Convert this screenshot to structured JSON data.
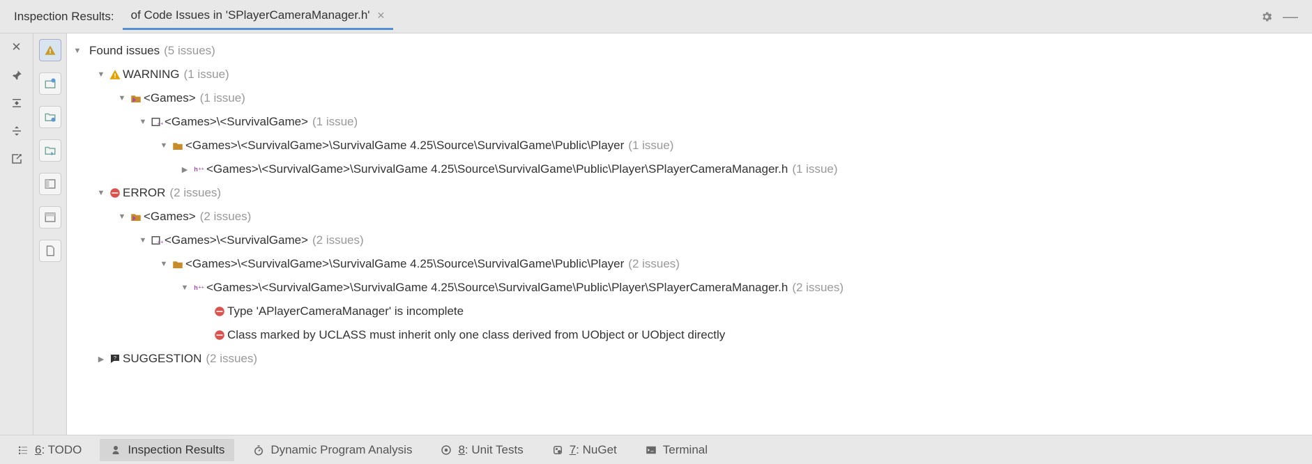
{
  "header": {
    "label": "Inspection Results:",
    "tab_title": "of Code Issues in 'SPlayerCameraManager.h'"
  },
  "tree": {
    "root_label": "Found issues",
    "root_count": "(5 issues)",
    "nodes": [
      {
        "depth": 1,
        "expanded": true,
        "icon": "warning",
        "label": "WARNING",
        "count": "(1 issue)"
      },
      {
        "depth": 2,
        "expanded": true,
        "icon": "project",
        "label": "<Games>",
        "count": "(1 issue)"
      },
      {
        "depth": 3,
        "expanded": true,
        "icon": "cpp-module",
        "label": "<Games>\\<SurvivalGame>",
        "count": "(1 issue)"
      },
      {
        "depth": 4,
        "expanded": true,
        "icon": "folder",
        "label": "<Games>\\<SurvivalGame>\\SurvivalGame 4.25\\Source\\SurvivalGame\\Public\\Player",
        "count": "(1 issue)"
      },
      {
        "depth": 5,
        "expanded": false,
        "icon": "hpp-file",
        "label": "<Games>\\<SurvivalGame>\\SurvivalGame 4.25\\Source\\SurvivalGame\\Public\\Player\\SPlayerCameraManager.h",
        "count": "(1 issue)"
      },
      {
        "depth": 1,
        "expanded": true,
        "icon": "error",
        "label": "ERROR",
        "count": "(2 issues)"
      },
      {
        "depth": 2,
        "expanded": true,
        "icon": "project",
        "label": "<Games>",
        "count": "(2 issues)"
      },
      {
        "depth": 3,
        "expanded": true,
        "icon": "cpp-module",
        "label": "<Games>\\<SurvivalGame>",
        "count": "(2 issues)"
      },
      {
        "depth": 4,
        "expanded": true,
        "icon": "folder",
        "label": "<Games>\\<SurvivalGame>\\SurvivalGame 4.25\\Source\\SurvivalGame\\Public\\Player",
        "count": "(2 issues)"
      },
      {
        "depth": 5,
        "expanded": true,
        "icon": "hpp-file",
        "label": "<Games>\\<SurvivalGame>\\SurvivalGame 4.25\\Source\\SurvivalGame\\Public\\Player\\SPlayerCameraManager.h",
        "count": "(2 issues)"
      },
      {
        "depth": 6,
        "expanded": null,
        "icon": "error",
        "label": "Type 'APlayerCameraManager' is incomplete",
        "count": ""
      },
      {
        "depth": 6,
        "expanded": null,
        "icon": "error",
        "label": "Class marked by UCLASS must inherit only one class derived from UObject or UObject directly",
        "count": ""
      },
      {
        "depth": 1,
        "expanded": false,
        "icon": "suggestion",
        "label": "SUGGESTION",
        "count": "(2 issues)"
      }
    ]
  },
  "footer": {
    "items": [
      {
        "icon": "todo",
        "underline": "6",
        "label": ": TODO",
        "active": false
      },
      {
        "icon": "inspect",
        "underline": "",
        "label": "Inspection Results",
        "active": true
      },
      {
        "icon": "stopwatch",
        "underline": "",
        "label": "Dynamic Program Analysis",
        "active": false
      },
      {
        "icon": "tests",
        "underline": "8",
        "label": ": Unit Tests",
        "active": false
      },
      {
        "icon": "nuget",
        "underline": "7",
        "label": ": NuGet",
        "active": false
      },
      {
        "icon": "terminal",
        "underline": "",
        "label": "Terminal",
        "active": false
      }
    ]
  },
  "left_rail2_active": 0
}
